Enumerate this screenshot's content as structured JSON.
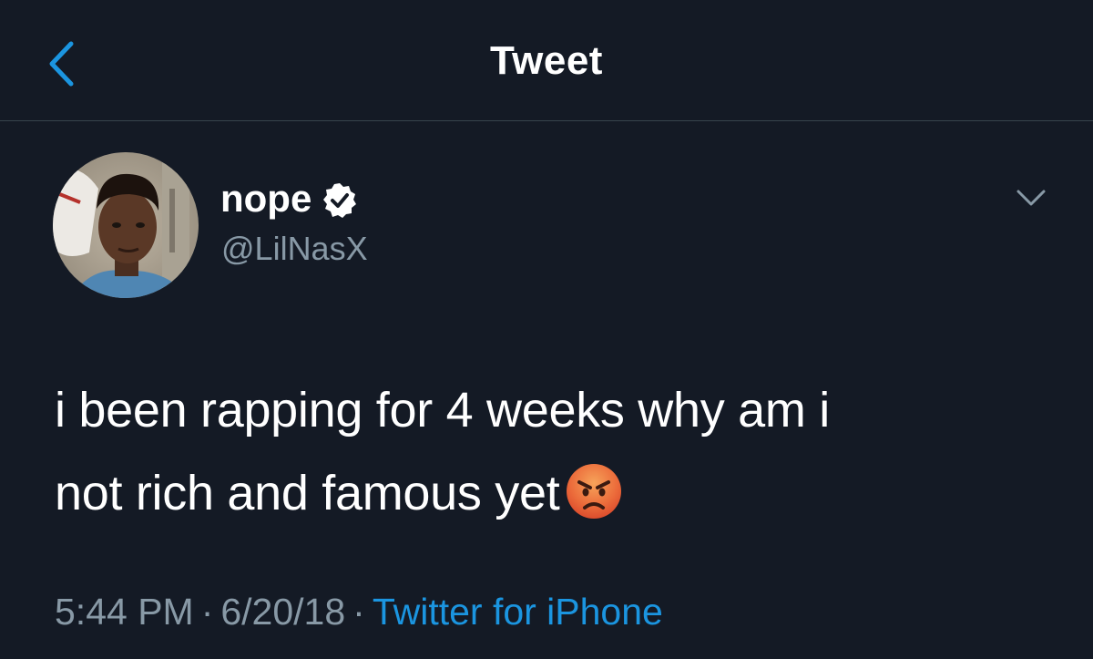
{
  "header": {
    "title": "Tweet",
    "back_icon": "chevron-left-icon"
  },
  "colors": {
    "background": "#141a25",
    "accent": "#1b95e0",
    "secondary_text": "#8899a6",
    "divider": "#38444d"
  },
  "tweet": {
    "author": {
      "display_name": "nope",
      "handle": "@LilNasX",
      "verified": true
    },
    "text_line_1": "i been rapping for 4 weeks why am i",
    "text_line_2": "not rich and famous yet",
    "emoji": "angry-face",
    "time": "5:44 PM",
    "date": "6/20/18",
    "source": "Twitter for iPhone",
    "separator": "·",
    "more_icon": "chevron-down-icon"
  }
}
